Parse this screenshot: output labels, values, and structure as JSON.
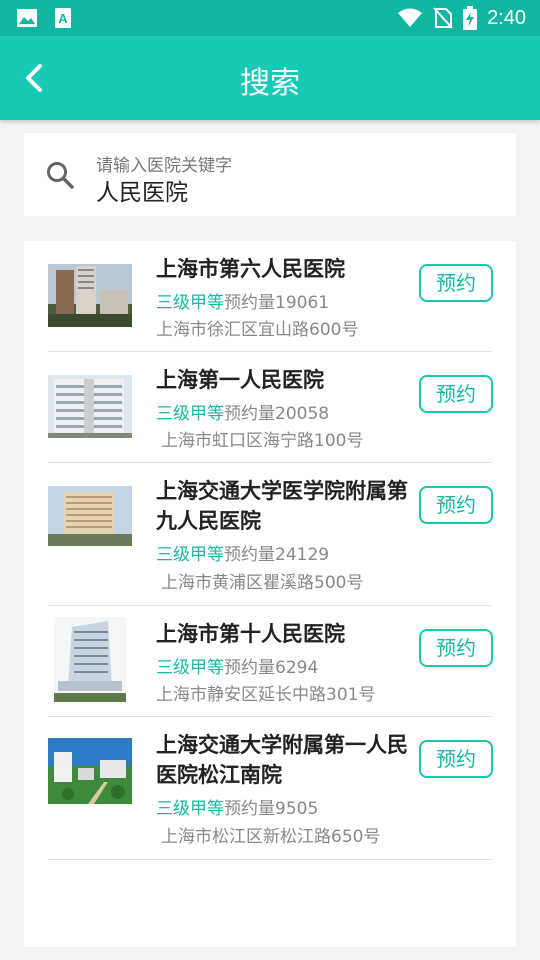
{
  "status_bar": {
    "time": "2:40",
    "icons": [
      "image-icon",
      "font-a-icon",
      "wifi-icon",
      "no-sim-icon",
      "battery-charging-icon"
    ]
  },
  "app_bar": {
    "title": "搜索",
    "back_icon": "chevron-left-icon"
  },
  "search": {
    "placeholder": "请输入医院关键字",
    "value": "人民医院",
    "icon": "search-icon"
  },
  "colors": {
    "primary": "#18c9b5",
    "status_bar": "#12b5a2",
    "level_text": "#19b8a6",
    "background": "#f2f3f5"
  },
  "results": [
    {
      "name": "上海市第六人民医院",
      "level": "三级甲等",
      "count_label": "预约量",
      "count": "19061",
      "address": "上海市徐汇区宜山路600号",
      "button": "预约"
    },
    {
      "name": "上海第一人民医院",
      "level": "三级甲等",
      "count_label": "预约量",
      "count": "20058",
      "address": "上海市虹口区海宁路100号",
      "button": "预约"
    },
    {
      "name": "上海交通大学医学院附属第九人民医院",
      "level": "三级甲等",
      "count_label": "预约量",
      "count": "24129",
      "address": "上海市黄浦区瞿溪路500号",
      "button": "预约"
    },
    {
      "name": "上海市第十人民医院",
      "level": "三级甲等",
      "count_label": "预约量",
      "count": "6294",
      "address": "上海市静安区延长中路301号",
      "button": "预约"
    },
    {
      "name": "上海交通大学附属第一人民医院松江南院",
      "level": "三级甲等",
      "count_label": "预约量",
      "count": "9505",
      "address": "上海市松江区新松江路650号",
      "button": "预约"
    }
  ]
}
